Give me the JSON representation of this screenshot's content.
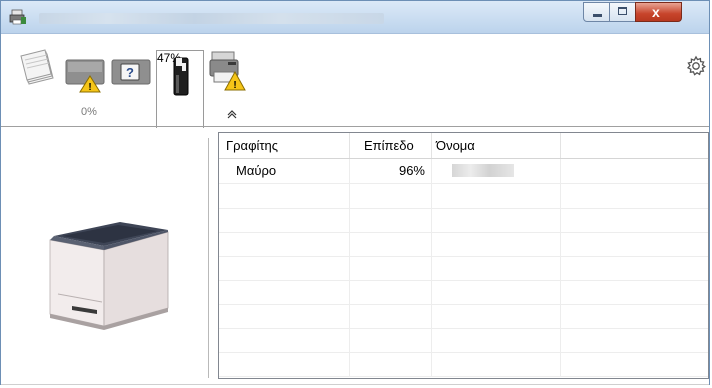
{
  "window": {
    "title": "",
    "buttons": {
      "minimize": "minimize",
      "maximize": "maximize",
      "close": "x"
    }
  },
  "toolbar": {
    "tabs": [
      {
        "name": "paper",
        "pct": ""
      },
      {
        "name": "toner-warning",
        "pct": "0%"
      },
      {
        "name": "toner-black",
        "pct": "47%"
      },
      {
        "name": "printer-warning",
        "pct": ""
      }
    ]
  },
  "table": {
    "headers": [
      "Γραφίτης",
      "Επίπεδο",
      "Όνομα",
      ""
    ],
    "rows": [
      {
        "toner": "Μαύρο",
        "level": "96%",
        "name": ""
      }
    ],
    "empty_rows": 8
  },
  "colors": {
    "titlebar": "#c4d8ee",
    "close": "#c7442b",
    "warning": "#f5c518",
    "toner": "#222222"
  }
}
